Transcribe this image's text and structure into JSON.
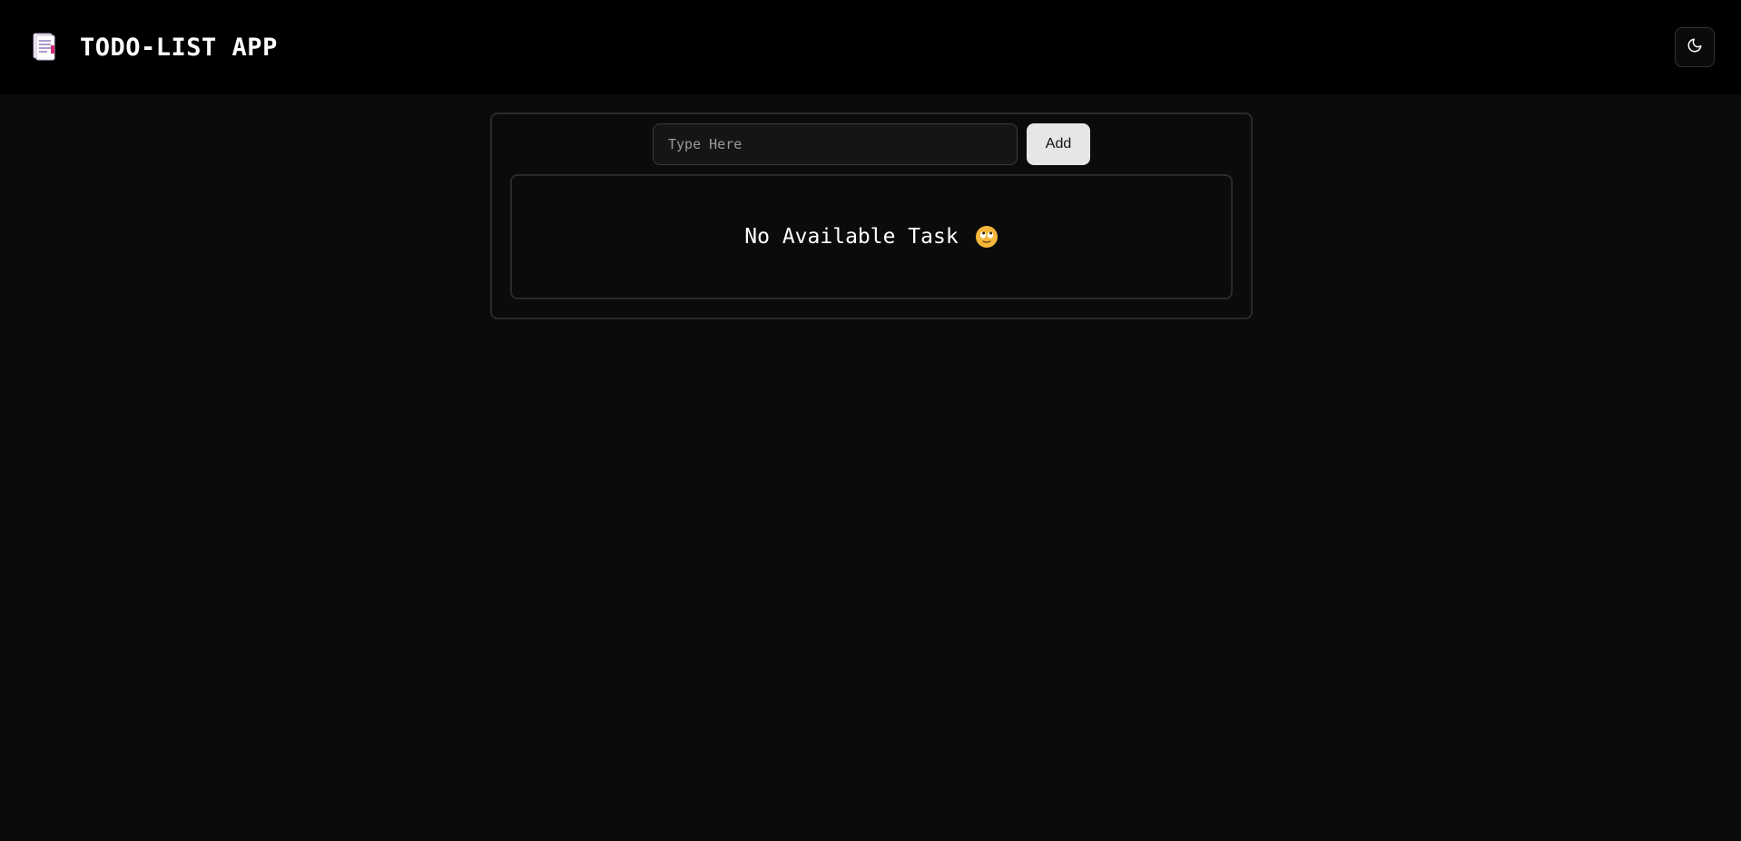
{
  "header": {
    "title": "TODO-LIST APP",
    "logo_icon": "notepad-icon",
    "theme_toggle_icon": "moon-icon"
  },
  "form": {
    "input_placeholder": "Type Here",
    "input_value": "",
    "add_label": "Add"
  },
  "tasks": {
    "items": [],
    "empty_message": "No Available Task",
    "empty_icon": "rolling-eyes-emoji-icon"
  },
  "colors": {
    "header_bg": "#000000",
    "page_bg": "#0b0b0b",
    "border": "#2a2a2a",
    "button_bg": "#e6e6e6"
  }
}
